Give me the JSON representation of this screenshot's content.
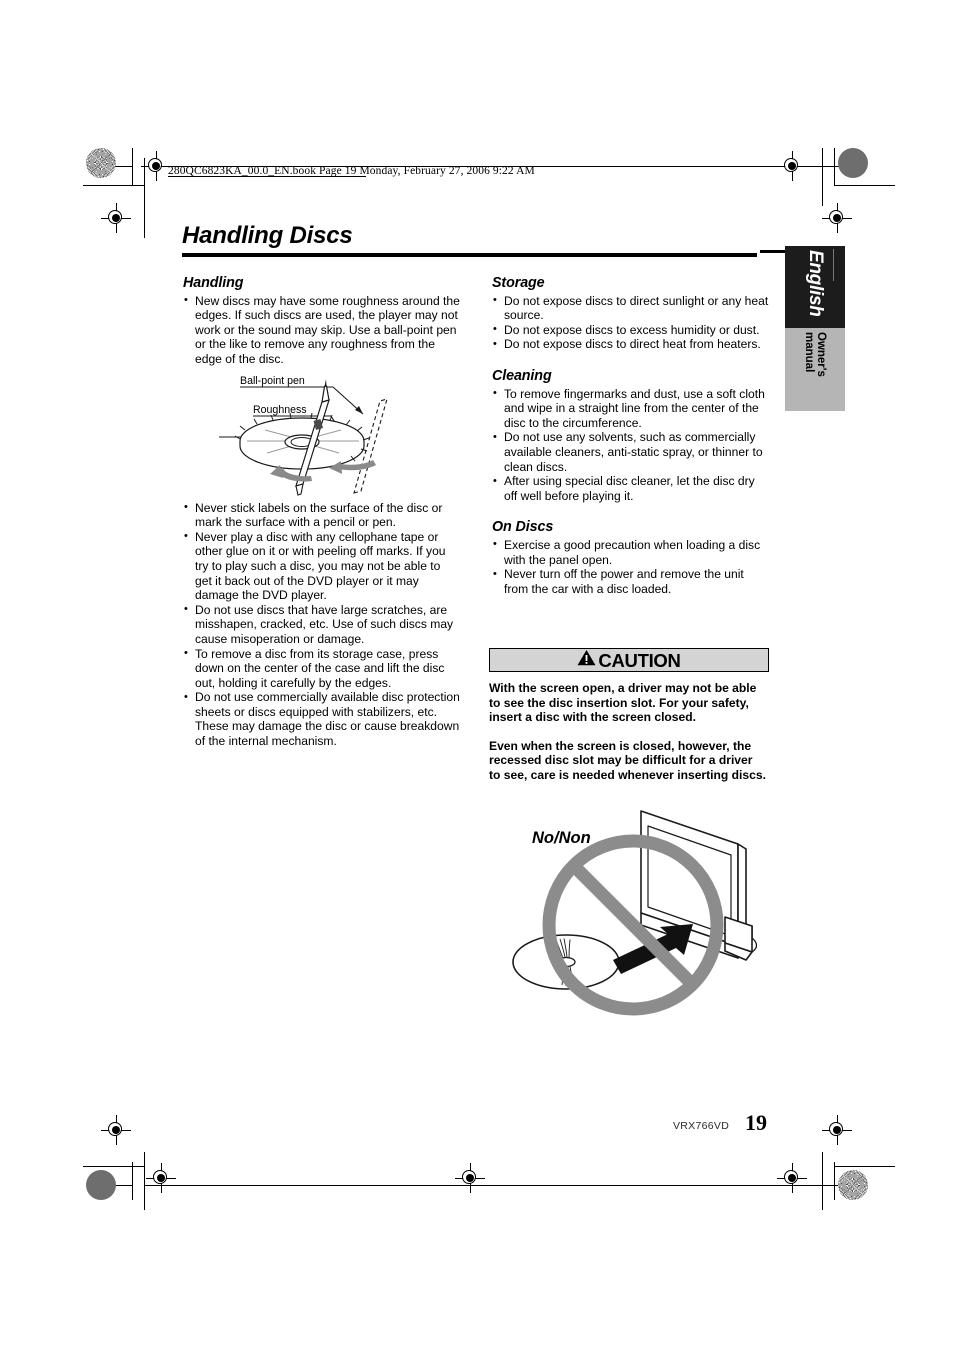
{
  "header": {
    "file_line": "280QC6823KA_00.0_EN.book  Page 19  Monday, February 27, 2006  9:22 AM"
  },
  "page_title": "Handling Discs",
  "left_column": {
    "sections": [
      {
        "heading": "Handling",
        "bullets": [
          "New discs may have some roughness around the edges. If such discs are used, the player may not work or the sound may skip. Use a ball-point pen or the like to remove any roughness from the edge of the disc."
        ]
      }
    ],
    "figure": {
      "name": "disc-pen-figure",
      "label_pen": "Ball-point pen",
      "label_roughness": "Roughness"
    },
    "bullets_after_figure": [
      "Never stick labels on the surface of the disc or mark the surface with a pencil or pen.",
      "Never play a disc with any cellophane tape or other glue on it or with peeling off marks. If you try to play such a disc, you may not be able to get it back out of the DVD player or it may damage the DVD player.",
      "Do not use discs that have large scratches, are misshapen, cracked, etc. Use of such discs may cause misoperation or damage.",
      "To remove a disc from its storage case, press down on the center of the case and lift the disc out, holding it carefully by the edges.",
      "Do not use commercially available disc protection sheets or discs equipped with stabilizers, etc. These may damage the disc or cause breakdown of the internal mechanism."
    ]
  },
  "right_column": {
    "sections": [
      {
        "heading": "Storage",
        "bullets": [
          "Do not expose discs to direct sunlight or any heat source.",
          "Do not expose discs to excess humidity or dust.",
          "Do not expose discs to direct heat from heaters."
        ]
      },
      {
        "heading": "Cleaning",
        "bullets": [
          "To remove fingermarks and dust, use a soft cloth and wipe in a straight line from the center of the disc to the circumference.",
          "Do not use any solvents, such as commercially available cleaners, anti-static spray, or thinner to clean discs.",
          "After using special disc cleaner, let the disc dry off well before playing it."
        ]
      },
      {
        "heading": "On Discs",
        "bullets": [
          "Exercise a good precaution when loading a disc with the panel open.",
          "Never turn off the power and remove the unit from the car with a disc loaded."
        ]
      }
    ]
  },
  "caution": {
    "title": "CAUTION",
    "icon": "warning-triangle-icon",
    "paragraph_1": "With the screen open, a driver may not be able to see the disc insertion slot. For your safety, insert a disc with the screen closed.",
    "paragraph_2": "Even when the screen is closed, however, the recessed disc slot may be difficult for a driver to see, care is needed whenever inserting discs.",
    "bar_background": "#d4d4d4"
  },
  "figure_nonon": {
    "label": "No/Non",
    "prohibition_color": "#8c8c8c"
  },
  "side_tab": {
    "language": "English",
    "manual": "Owner's manual",
    "language_bg": "#1c1c1c",
    "manual_bg": "#b5b5b5"
  },
  "footer": {
    "model": "VRX766VD",
    "page_number": "19"
  }
}
